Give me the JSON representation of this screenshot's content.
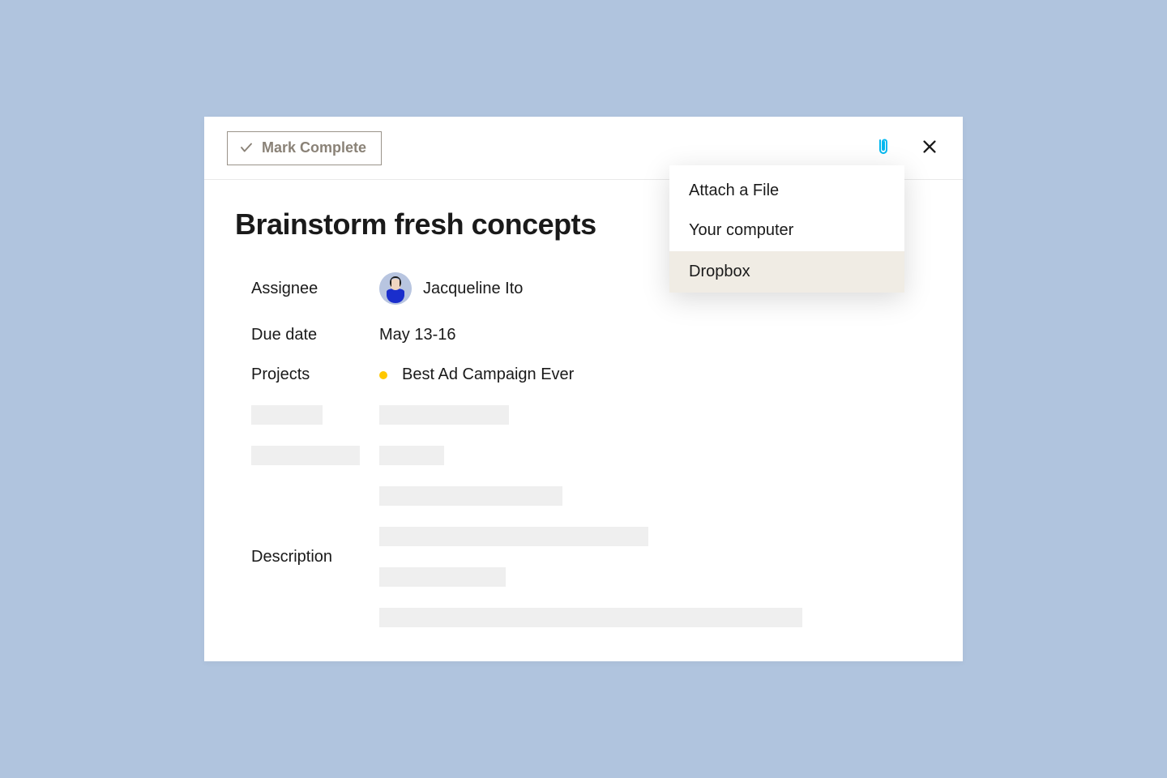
{
  "header": {
    "mark_complete_label": "Mark Complete"
  },
  "task": {
    "title": "Brainstorm fresh concepts",
    "fields": {
      "assignee_label": "Assignee",
      "assignee_name": "Jacqueline Ito",
      "due_date_label": "Due date",
      "due_date_value": "May 13-16",
      "projects_label": "Projects",
      "project_name": "Best Ad Campaign Ever",
      "description_label": "Description"
    }
  },
  "attach_popover": {
    "title": "Attach a File",
    "items": [
      {
        "label": "Your computer",
        "highlighted": false
      },
      {
        "label": "Dropbox",
        "highlighted": true
      }
    ]
  },
  "colors": {
    "project_dot": "#ffc800",
    "attachment_icon": "#00b8f0"
  }
}
